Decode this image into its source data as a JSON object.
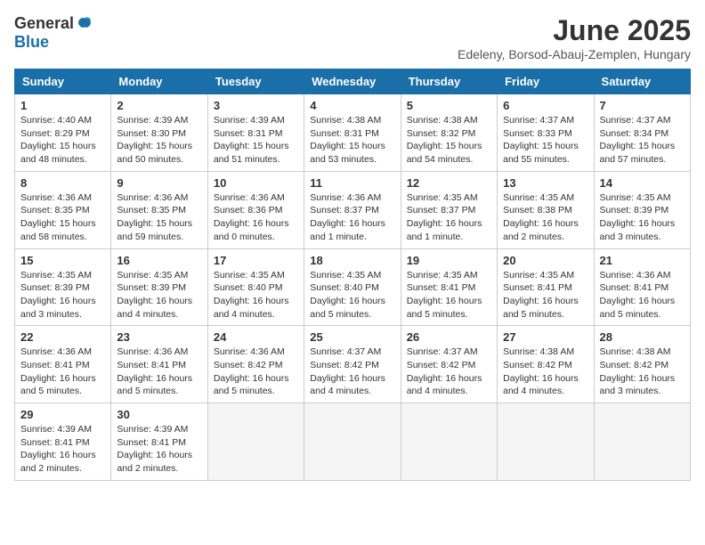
{
  "logo": {
    "general": "General",
    "blue": "Blue"
  },
  "title": "June 2025",
  "subtitle": "Edeleny, Borsod-Abauj-Zemplen, Hungary",
  "days_of_week": [
    "Sunday",
    "Monday",
    "Tuesday",
    "Wednesday",
    "Thursday",
    "Friday",
    "Saturday"
  ],
  "weeks": [
    [
      {
        "day": "1",
        "info": "Sunrise: 4:40 AM\nSunset: 8:29 PM\nDaylight: 15 hours\nand 48 minutes."
      },
      {
        "day": "2",
        "info": "Sunrise: 4:39 AM\nSunset: 8:30 PM\nDaylight: 15 hours\nand 50 minutes."
      },
      {
        "day": "3",
        "info": "Sunrise: 4:39 AM\nSunset: 8:31 PM\nDaylight: 15 hours\nand 51 minutes."
      },
      {
        "day": "4",
        "info": "Sunrise: 4:38 AM\nSunset: 8:31 PM\nDaylight: 15 hours\nand 53 minutes."
      },
      {
        "day": "5",
        "info": "Sunrise: 4:38 AM\nSunset: 8:32 PM\nDaylight: 15 hours\nand 54 minutes."
      },
      {
        "day": "6",
        "info": "Sunrise: 4:37 AM\nSunset: 8:33 PM\nDaylight: 15 hours\nand 55 minutes."
      },
      {
        "day": "7",
        "info": "Sunrise: 4:37 AM\nSunset: 8:34 PM\nDaylight: 15 hours\nand 57 minutes."
      }
    ],
    [
      {
        "day": "8",
        "info": "Sunrise: 4:36 AM\nSunset: 8:35 PM\nDaylight: 15 hours\nand 58 minutes."
      },
      {
        "day": "9",
        "info": "Sunrise: 4:36 AM\nSunset: 8:35 PM\nDaylight: 15 hours\nand 59 minutes."
      },
      {
        "day": "10",
        "info": "Sunrise: 4:36 AM\nSunset: 8:36 PM\nDaylight: 16 hours\nand 0 minutes."
      },
      {
        "day": "11",
        "info": "Sunrise: 4:36 AM\nSunset: 8:37 PM\nDaylight: 16 hours\nand 1 minute."
      },
      {
        "day": "12",
        "info": "Sunrise: 4:35 AM\nSunset: 8:37 PM\nDaylight: 16 hours\nand 1 minute."
      },
      {
        "day": "13",
        "info": "Sunrise: 4:35 AM\nSunset: 8:38 PM\nDaylight: 16 hours\nand 2 minutes."
      },
      {
        "day": "14",
        "info": "Sunrise: 4:35 AM\nSunset: 8:39 PM\nDaylight: 16 hours\nand 3 minutes."
      }
    ],
    [
      {
        "day": "15",
        "info": "Sunrise: 4:35 AM\nSunset: 8:39 PM\nDaylight: 16 hours\nand 3 minutes."
      },
      {
        "day": "16",
        "info": "Sunrise: 4:35 AM\nSunset: 8:39 PM\nDaylight: 16 hours\nand 4 minutes."
      },
      {
        "day": "17",
        "info": "Sunrise: 4:35 AM\nSunset: 8:40 PM\nDaylight: 16 hours\nand 4 minutes."
      },
      {
        "day": "18",
        "info": "Sunrise: 4:35 AM\nSunset: 8:40 PM\nDaylight: 16 hours\nand 5 minutes."
      },
      {
        "day": "19",
        "info": "Sunrise: 4:35 AM\nSunset: 8:41 PM\nDaylight: 16 hours\nand 5 minutes."
      },
      {
        "day": "20",
        "info": "Sunrise: 4:35 AM\nSunset: 8:41 PM\nDaylight: 16 hours\nand 5 minutes."
      },
      {
        "day": "21",
        "info": "Sunrise: 4:36 AM\nSunset: 8:41 PM\nDaylight: 16 hours\nand 5 minutes."
      }
    ],
    [
      {
        "day": "22",
        "info": "Sunrise: 4:36 AM\nSunset: 8:41 PM\nDaylight: 16 hours\nand 5 minutes."
      },
      {
        "day": "23",
        "info": "Sunrise: 4:36 AM\nSunset: 8:41 PM\nDaylight: 16 hours\nand 5 minutes."
      },
      {
        "day": "24",
        "info": "Sunrise: 4:36 AM\nSunset: 8:42 PM\nDaylight: 16 hours\nand 5 minutes."
      },
      {
        "day": "25",
        "info": "Sunrise: 4:37 AM\nSunset: 8:42 PM\nDaylight: 16 hours\nand 4 minutes."
      },
      {
        "day": "26",
        "info": "Sunrise: 4:37 AM\nSunset: 8:42 PM\nDaylight: 16 hours\nand 4 minutes."
      },
      {
        "day": "27",
        "info": "Sunrise: 4:38 AM\nSunset: 8:42 PM\nDaylight: 16 hours\nand 4 minutes."
      },
      {
        "day": "28",
        "info": "Sunrise: 4:38 AM\nSunset: 8:42 PM\nDaylight: 16 hours\nand 3 minutes."
      }
    ],
    [
      {
        "day": "29",
        "info": "Sunrise: 4:39 AM\nSunset: 8:41 PM\nDaylight: 16 hours\nand 2 minutes."
      },
      {
        "day": "30",
        "info": "Sunrise: 4:39 AM\nSunset: 8:41 PM\nDaylight: 16 hours\nand 2 minutes."
      },
      {
        "day": "",
        "info": ""
      },
      {
        "day": "",
        "info": ""
      },
      {
        "day": "",
        "info": ""
      },
      {
        "day": "",
        "info": ""
      },
      {
        "day": "",
        "info": ""
      }
    ]
  ]
}
